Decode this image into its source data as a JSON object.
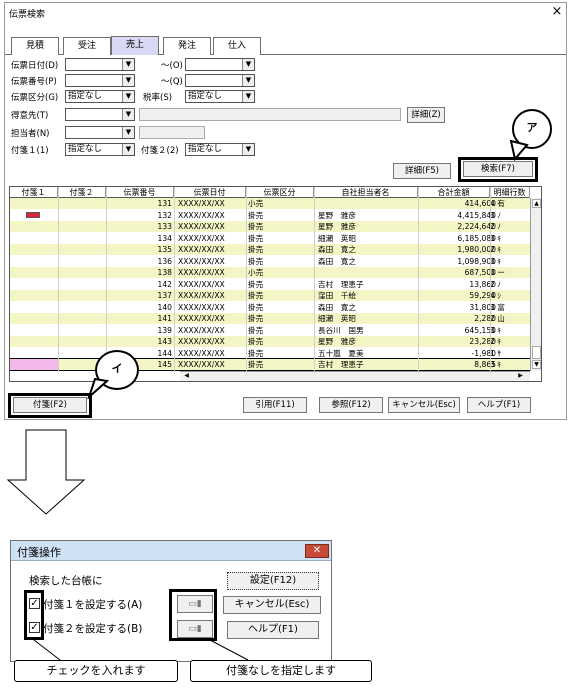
{
  "window": {
    "title": "伝票検索",
    "close": "×"
  },
  "tabs": [
    {
      "label": "見積",
      "active": false
    },
    {
      "label": "受注",
      "active": false
    },
    {
      "label": "売上",
      "active": true
    },
    {
      "label": "発注",
      "active": false
    },
    {
      "label": "仕入",
      "active": false
    }
  ],
  "form": {
    "date_label": "伝票日付(D)",
    "tilde1": "〜(O)",
    "number_label": "伝票番号(P)",
    "tilde2": "〜(Q)",
    "kubun_label": "伝票区分(G)",
    "kubun_value": "指定なし",
    "tax_label": "税率(S)",
    "tax_value": "指定なし",
    "customer_label": "得意先(T)",
    "detail_btn": "詳細(Z)",
    "person_label": "担当者(N)",
    "tag1_label": "付箋１(1)",
    "tag1_value": "指定なし",
    "tag2_label": "付箋２(2)",
    "tag2_value": "指定なし",
    "detail_f5": "詳細(F5)",
    "search_f7": "検索(F7)"
  },
  "grid": {
    "headers": [
      "付箋１",
      "付箋２",
      "伝票番号",
      "伝票日付",
      "伝票区分",
      "自社担当者名",
      "合計金額",
      "明細行数"
    ],
    "rows": [
      {
        "no": "131",
        "date": "XXXX/XX/XX",
        "kb": "小売",
        "name": "",
        "amount": "414,600",
        "lines": "4 有",
        "hl": true
      },
      {
        "no": "132",
        "date": "XXXX/XX/XX",
        "kb": "掛売",
        "name": "星野　雅彦",
        "amount": "4,415,840",
        "lines": "3 ﾉ",
        "hl": false,
        "tag": true
      },
      {
        "no": "133",
        "date": "XXXX/XX/XX",
        "kb": "掛売",
        "name": "星野　雅彦",
        "amount": "2,224,640",
        "lines": "2 ﾉ",
        "hl": true
      },
      {
        "no": "134",
        "date": "XXXX/XX/XX",
        "kb": "掛売",
        "name": "細瀬　英昭",
        "amount": "6,185,080",
        "lines": "3 ｷ",
        "hl": false
      },
      {
        "no": "135",
        "date": "XXXX/XX/XX",
        "kb": "掛売",
        "name": "森田　寛之",
        "amount": "1,980,000",
        "lines": "2 ｷ",
        "hl": true
      },
      {
        "no": "136",
        "date": "XXXX/XX/XX",
        "kb": "掛売",
        "name": "森田　寛之",
        "amount": "1,098,900",
        "lines": "3 ｷ",
        "hl": false
      },
      {
        "no": "138",
        "date": "XXXX/XX/XX",
        "kb": "小売",
        "name": "",
        "amount": "687,500",
        "lines": "3 ー",
        "hl": true
      },
      {
        "no": "142",
        "date": "XXXX/XX/XX",
        "kb": "掛売",
        "name": "吉村　理恵子",
        "amount": "13,860",
        "lines": "2 ﾉ",
        "hl": false
      },
      {
        "no": "137",
        "date": "XXXX/XX/XX",
        "kb": "掛売",
        "name": "窪田　千絵",
        "amount": "59,290",
        "lines": "4 ｼ",
        "hl": true
      },
      {
        "no": "140",
        "date": "XXXX/XX/XX",
        "kb": "掛売",
        "name": "森田　寛之",
        "amount": "31,800",
        "lines": "3 富",
        "hl": false
      },
      {
        "no": "141",
        "date": "XXXX/XX/XX",
        "kb": "掛売",
        "name": "細瀬　英昭",
        "amount": "2,280",
        "lines": "2 山",
        "hl": true
      },
      {
        "no": "139",
        "date": "XXXX/XX/XX",
        "kb": "掛売",
        "name": "長谷川　国男",
        "amount": "645,150",
        "lines": "3 ｷ",
        "hl": false
      },
      {
        "no": "143",
        "date": "XXXX/XX/XX",
        "kb": "掛売",
        "name": "星野　雅彦",
        "amount": "23,280",
        "lines": "2 ｷ",
        "hl": true
      },
      {
        "no": "144",
        "date": "XXXX/XX/XX",
        "kb": "掛売",
        "name": "五十嵐　夏美",
        "amount": "-1,980",
        "lines": "1 ｻ",
        "hl": false
      },
      {
        "no": "145",
        "date": "XXXX/XX/XX",
        "kb": "掛売",
        "name": "吉村　理恵子",
        "amount": "8,865",
        "lines": "3 ｷ",
        "hl": true,
        "selected": true
      }
    ]
  },
  "bottom_buttons": {
    "tag": "付箋(F2)",
    "ref": "引用(F11)",
    "look": "参照(F12)",
    "cancel": "キャンセル(Esc)",
    "help": "ヘルプ(F1)"
  },
  "callouts": {
    "a": "ア",
    "i": "イ"
  },
  "dialog": {
    "title": "付箋操作",
    "close": "✕",
    "caption": "検索した台帳に",
    "check1": "付箋１を設定する(A)",
    "check2": "付箋２を設定する(B)",
    "set_btn": "設定(F12)",
    "cancel_btn": "キャンセル(Esc)",
    "help_btn": "ヘルプ(F1)"
  },
  "labels": {
    "check": "チェックを入れます",
    "none": "付箋なしを指定します"
  },
  "colors": {
    "row_highlight": "#f3f5c5",
    "selected_pink": "#f2b8e8",
    "tab_active": "#d8d8f5"
  }
}
